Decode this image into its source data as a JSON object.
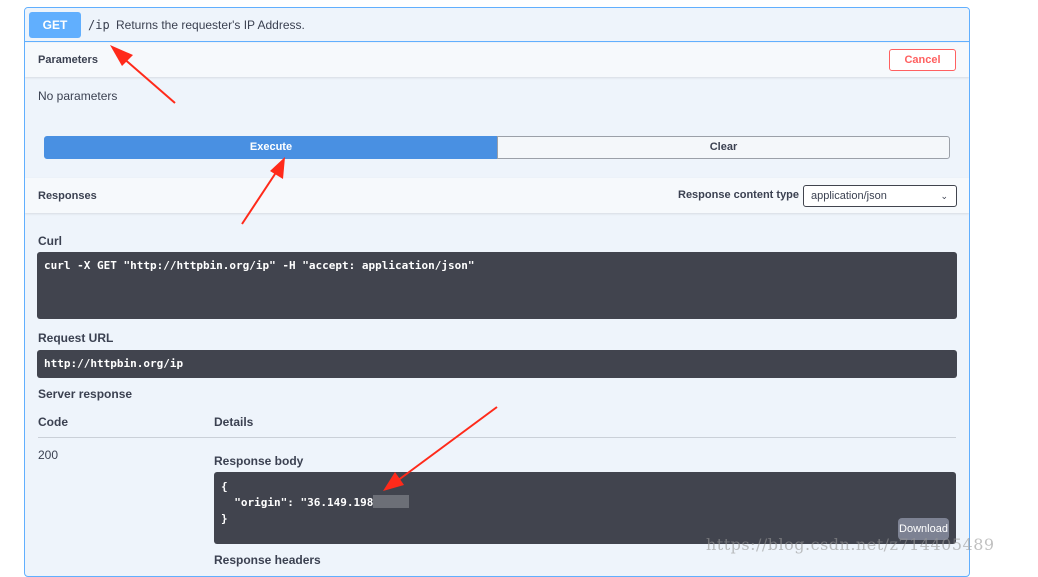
{
  "summary": {
    "method": "GET",
    "path": "/ip",
    "description": "Returns the requester's IP Address."
  },
  "parameters": {
    "title": "Parameters",
    "cancel_label": "Cancel",
    "empty_text": "No parameters"
  },
  "actions": {
    "execute_label": "Execute",
    "clear_label": "Clear"
  },
  "responses": {
    "title": "Responses",
    "content_type_label": "Response content type",
    "content_type_value": "application/json"
  },
  "curl": {
    "label": "Curl",
    "command": "curl -X GET \"http://httpbin.org/ip\" -H \"accept: application/json\""
  },
  "request_url": {
    "label": "Request URL",
    "value": "http://httpbin.org/ip"
  },
  "server_response": {
    "title": "Server response",
    "code_header": "Code",
    "details_header": "Details",
    "code": "200",
    "body_label": "Response body",
    "body_open": "{",
    "body_line": "  \"origin\": \"36.149.198",
    "body_close": "}",
    "download_label": "Download",
    "headers_label": "Response headers"
  },
  "annotations": {
    "arrow_color": "#ff2a1a"
  },
  "watermark": "https://blog.csdn.net/z714405489"
}
